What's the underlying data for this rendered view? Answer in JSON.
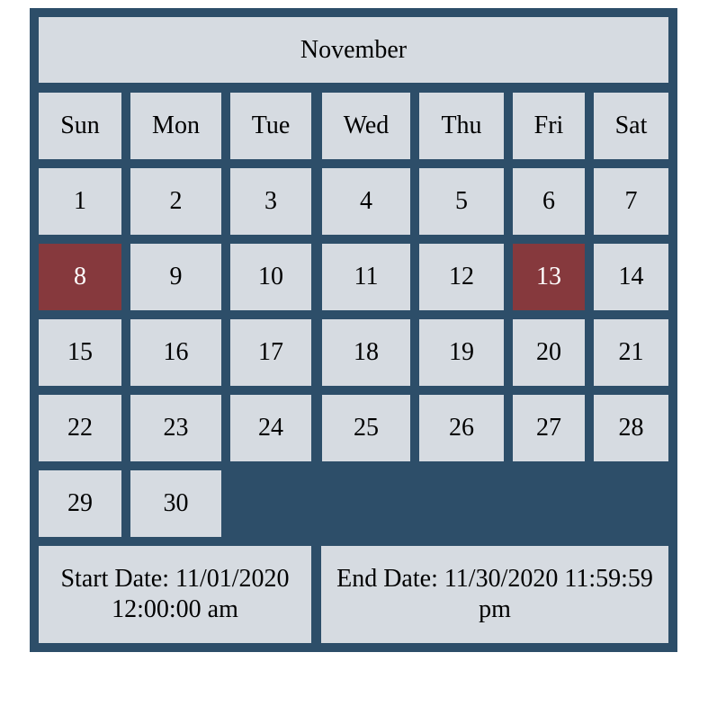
{
  "calendar": {
    "month": "November",
    "weekdays": [
      "Sun",
      "Mon",
      "Tue",
      "Wed",
      "Thu",
      "Fri",
      "Sat"
    ],
    "first_weekday_index": 0,
    "days": [
      "1",
      "2",
      "3",
      "4",
      "5",
      "6",
      "7",
      "8",
      "9",
      "10",
      "11",
      "12",
      "13",
      "14",
      "15",
      "16",
      "17",
      "18",
      "19",
      "20",
      "21",
      "22",
      "23",
      "24",
      "25",
      "26",
      "27",
      "28",
      "29",
      "30"
    ],
    "selected_days": [
      "8",
      "13"
    ],
    "start_date": "Start Date: 11/01/2020 12:00:00 am",
    "end_date": "End Date: 11/30/2020 11:59:59 pm"
  },
  "colors": {
    "frame": "#2d4e69",
    "cell": "#d6dbe1",
    "selected": "#86393d",
    "selected_text": "#ffffff"
  }
}
